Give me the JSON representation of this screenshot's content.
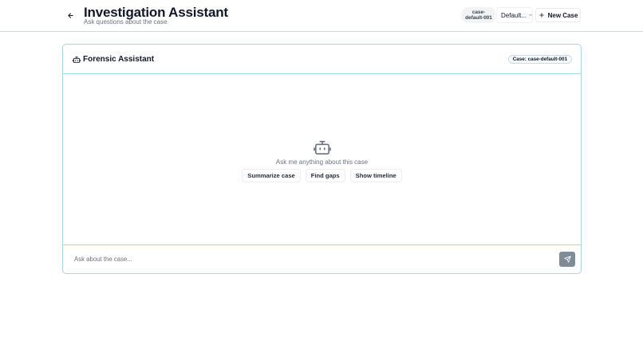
{
  "header": {
    "title": "Investigation Assistant",
    "subtitle": "Ask questions about the case",
    "case_badge": {
      "line1": "case-",
      "line2": "default-001"
    },
    "case_select_value": "Default...",
    "new_case_label": "New Case"
  },
  "assistant": {
    "title": "Forensic Assistant",
    "case_badge": "Case: case-default-001",
    "empty_prompt": "Ask me anything about this case",
    "suggestions": [
      {
        "label": "Summarize case"
      },
      {
        "label": "Find gaps"
      },
      {
        "label": "Show timeline"
      }
    ],
    "input_placeholder": "Ask about the case...",
    "input_value": ""
  },
  "icons": {
    "back": "arrow-left-icon",
    "dropdown": "chevron-down-icon",
    "new_case": "plus-icon",
    "assistant": "bot-icon",
    "send": "send-icon"
  },
  "colors": {
    "border_accent": "#a9d3e6",
    "send_button": "#7f8b96",
    "muted_text": "#6b7280"
  }
}
